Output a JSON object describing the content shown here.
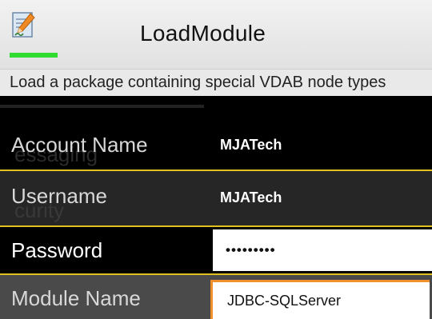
{
  "app": {
    "title": "LoadModule",
    "icon": "edit-document-icon",
    "progress": 0.14,
    "description": "Load a package containing special VDAB node types"
  },
  "background_text": {
    "line1": "essaging",
    "line2": "curity"
  },
  "form": {
    "account_name": {
      "label": "Account Name",
      "value": "MJATech"
    },
    "username": {
      "label": "Username",
      "value": "MJATech"
    },
    "password": {
      "label": "Password",
      "value": "•••••••••"
    },
    "module_name": {
      "label": "Module Name",
      "value": "JDBC-SQLServer"
    }
  },
  "colors": {
    "accent_divider": "#e1c11f",
    "progress": "#2fdc2f",
    "focus_border": "#f0902a"
  }
}
